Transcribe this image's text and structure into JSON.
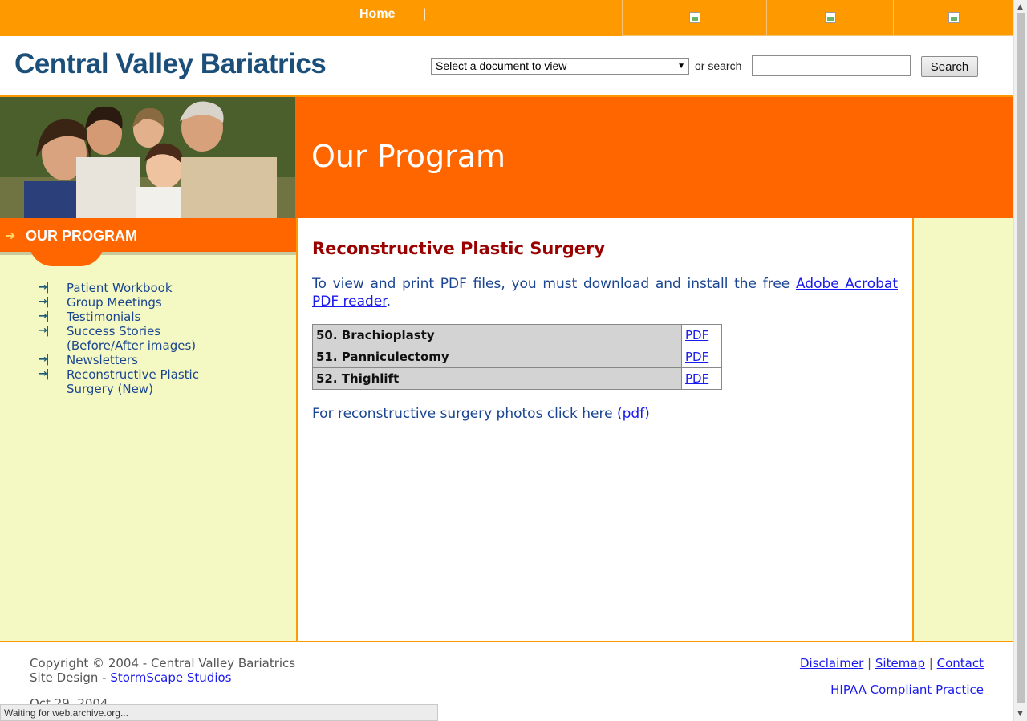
{
  "topnav": {
    "home": "Home",
    "separator": "|"
  },
  "header": {
    "logo": "Central Valley Bariatrics",
    "doc_select": "Select a document to view",
    "or_search": "or search",
    "search_button": "Search"
  },
  "banner": {
    "title": "Our Program"
  },
  "sidebar": {
    "heading": "OUR PROGRAM",
    "items": [
      {
        "label": "Patient Workbook"
      },
      {
        "label": "Group Meetings"
      },
      {
        "label": "Testimonials"
      },
      {
        "label": "Success Stories (Before/After images)"
      },
      {
        "label": "Newsletters"
      },
      {
        "label": "Reconstructive Plastic Surgery (New)"
      }
    ]
  },
  "main": {
    "title": "Reconstructive Plastic Surgery",
    "pdf_note_pre": "To view and print PDF files, you must download and install the free ",
    "pdf_note_link": "Adobe Acrobat PDF reader",
    "pdf_note_post": ".",
    "documents": [
      {
        "name": "50. Brachioplasty",
        "link": "PDF"
      },
      {
        "name": "51. Panniculectomy",
        "link": "PDF"
      },
      {
        "name": "52. Thighlift",
        "link": "PDF"
      }
    ],
    "photos_text": "For reconstructive surgery photos click here",
    "photos_link": "(pdf)"
  },
  "footer": {
    "copyright": "Copyright © 2004 - Central Valley Bariatrics",
    "site_design_label": "Site Design - ",
    "site_design_link": "StormScape Studios",
    "date": "Oct 29, 2004",
    "links": [
      "Disclaimer",
      "Sitemap",
      "Contact"
    ],
    "link_separator": "|",
    "hipaa": "HIPAA Compliant Practice"
  },
  "statusbar": {
    "text": "Waiting for web.archive.org..."
  },
  "colors": {
    "topbar": "#ff9900",
    "banner": "#ff6600",
    "sidebar_bg": "#f4f8c2",
    "logo": "#1b4f79",
    "title": "#990000",
    "text": "#1a4590"
  }
}
